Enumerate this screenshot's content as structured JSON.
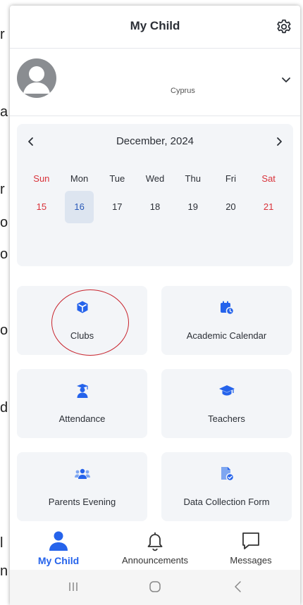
{
  "background_letters": [
    "r",
    "a",
    "r",
    "o",
    "o",
    "o",
    "d",
    "l",
    "n"
  ],
  "header": {
    "title": "My Child"
  },
  "profile": {
    "country": "Cyprus"
  },
  "calendar": {
    "month": "December, 2024",
    "days": [
      "Sun",
      "Mon",
      "Tue",
      "Wed",
      "Thu",
      "Fri",
      "Sat"
    ],
    "dates": [
      "15",
      "16",
      "17",
      "18",
      "19",
      "20",
      "21"
    ],
    "selected": "16"
  },
  "tiles": [
    {
      "label": "Clubs",
      "icon": "cube-icon"
    },
    {
      "label": "Academic Calendar",
      "icon": "calendar-clock-icon"
    },
    {
      "label": "Attendance",
      "icon": "graduate-icon"
    },
    {
      "label": "Teachers",
      "icon": "mortarboard-icon"
    },
    {
      "label": "Parents Evening",
      "icon": "group-icon"
    },
    {
      "label": "Data Collection Form",
      "icon": "document-check-icon"
    }
  ],
  "nav": [
    {
      "label": "My Child",
      "icon": "person-icon",
      "active": true
    },
    {
      "label": "Announcements",
      "icon": "bell-icon"
    },
    {
      "label": "Messages",
      "icon": "chat-icon"
    }
  ],
  "colors": {
    "accent": "#2563eb",
    "weekend": "#d9323a",
    "tile_bg": "#f3f5f8"
  }
}
